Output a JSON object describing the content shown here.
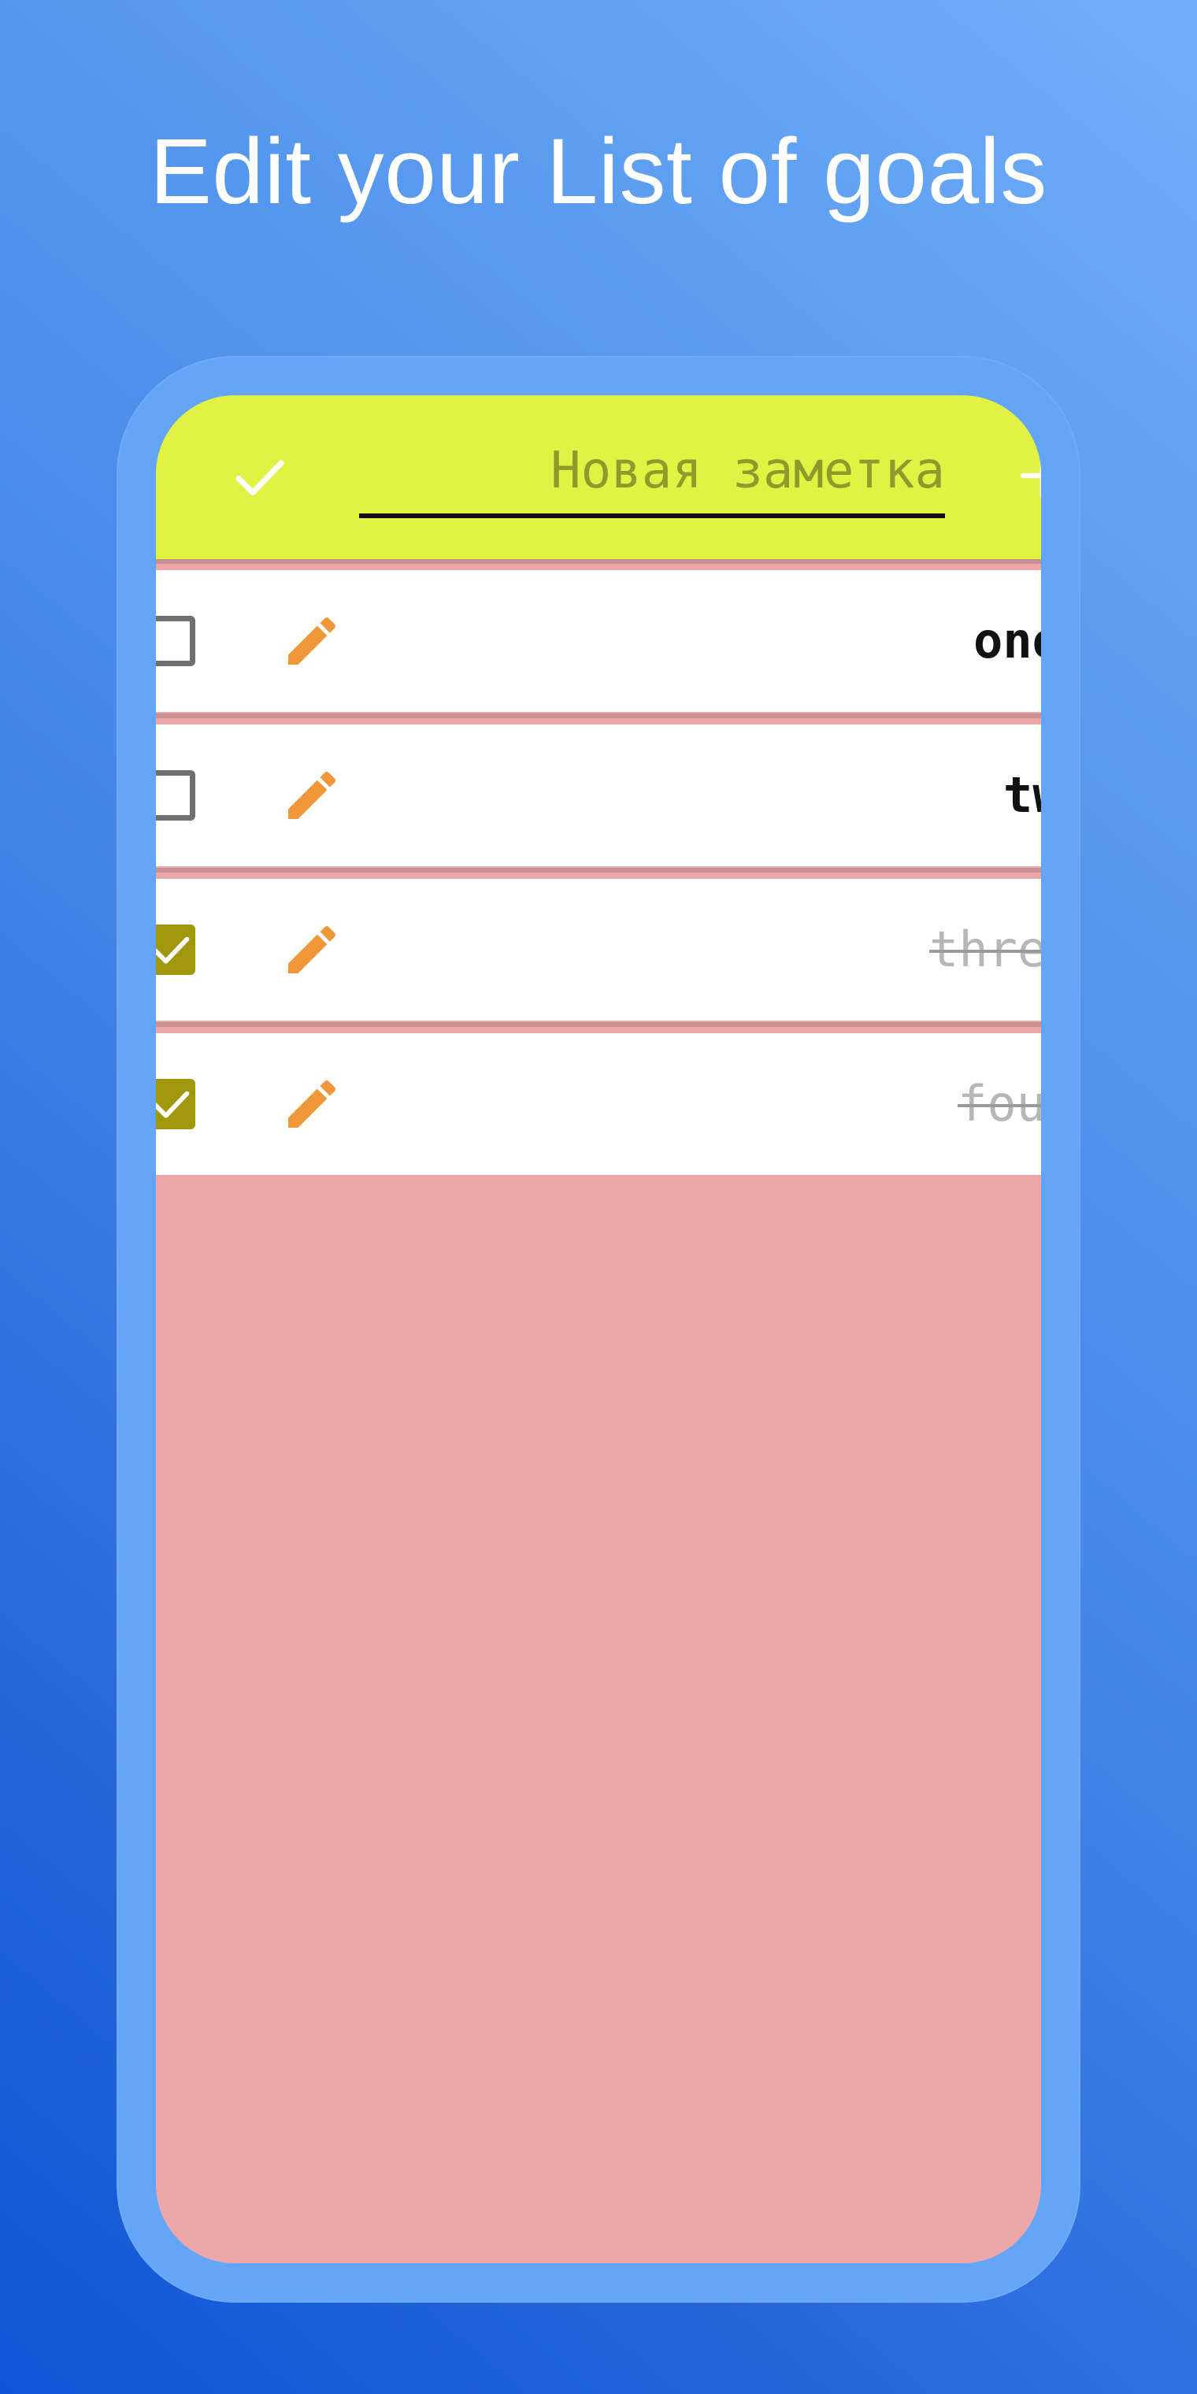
{
  "headline": "Edit your List of goals",
  "toolbar": {
    "confirm_icon": "check-icon",
    "input_placeholder": "Новая заметка",
    "input_value": "",
    "add_icon": "plus-icon",
    "background_color": "#e0f343"
  },
  "list": {
    "items": [
      {
        "label": "one",
        "checked": false,
        "edit_icon": "pencil-icon"
      },
      {
        "label": "two",
        "checked": false,
        "edit_icon": "pencil-icon"
      },
      {
        "label": "three",
        "checked": true,
        "edit_icon": "pencil-icon"
      },
      {
        "label": "four",
        "checked": true,
        "edit_icon": "pencil-icon"
      }
    ]
  },
  "colors": {
    "list_background": "#eca8a8",
    "checkbox_checked": "#a1970a",
    "pencil": "#f0973a",
    "frame": "#65a5f7"
  }
}
